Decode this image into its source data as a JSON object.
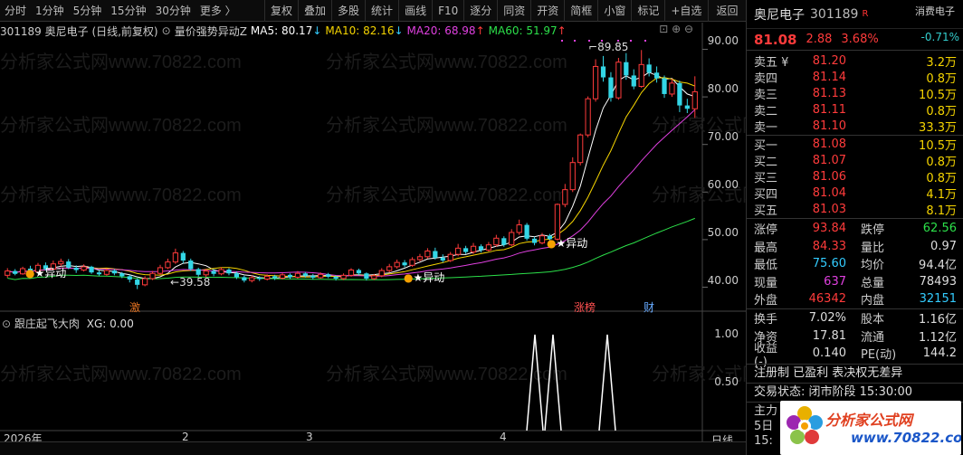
{
  "toolbar": {
    "period_tabs": [
      "分时",
      "1分钟",
      "5分钟",
      "15分钟",
      "30分钟",
      "更多 〉"
    ],
    "tool_buttons": [
      "复权",
      "叠加",
      "多股",
      "统计",
      "画线",
      "F10",
      "逐分",
      "同资",
      "开资",
      "简框",
      "小窗",
      "标记",
      "+自选"
    ],
    "back_label": "返回"
  },
  "indicator_bar": {
    "stock_info": "301189 奥尼电子 (日线,前复权)",
    "indicator_name": "量价强势异动Z",
    "ma5": "MA5: 80.17",
    "ma10": "MA10: 82.16",
    "ma20": "MA20: 68.98",
    "ma60": "MA60: 51.97"
  },
  "main_chart": {
    "axis_labels": [
      "90.00",
      "80.00",
      "70.00",
      "60.00",
      "50.00",
      "40.00"
    ],
    "high_annotation": "89.85",
    "low_annotation": "39.58",
    "signal_label": "★异动",
    "markers": {
      "ji": "激",
      "zhangting": "涨榜",
      "cai": "财"
    },
    "watermark": "分析家公式网www.70822.com"
  },
  "sub_chart": {
    "title": "跟庄起飞大肉",
    "xg_label": "XG: 0.00",
    "axis_labels": [
      "1.00",
      "0.50"
    ]
  },
  "time_axis": {
    "labels": [
      "2026年",
      "2",
      "3",
      "4"
    ],
    "period_label": "日线"
  },
  "colors": {
    "up": "#ff3b3b",
    "down": "#33d6e6",
    "ma5": "#ffffff",
    "ma10": "#f5d400",
    "ma20": "#e040e0",
    "ma60": "#2ce04a"
  },
  "quote": {
    "name": "奥尼电子",
    "code": "301189",
    "badge": "R",
    "sector_name": "消费电子",
    "sector_pct": "-0.71%",
    "price": "81.08",
    "change": "2.88",
    "pct": "3.68%",
    "asks": [
      {
        "label": "卖五 ¥",
        "price": "81.20",
        "vol": "3.2万"
      },
      {
        "label": "卖四",
        "price": "81.14",
        "vol": "0.8万"
      },
      {
        "label": "卖三",
        "price": "81.13",
        "vol": "10.5万"
      },
      {
        "label": "卖二",
        "price": "81.11",
        "vol": "0.8万"
      },
      {
        "label": "卖一",
        "price": "81.10",
        "vol": "33.3万"
      }
    ],
    "bids": [
      {
        "label": "买一",
        "price": "81.08",
        "vol": "10.5万"
      },
      {
        "label": "买二",
        "price": "81.07",
        "vol": "0.8万"
      },
      {
        "label": "买三",
        "price": "81.06",
        "vol": "0.8万"
      },
      {
        "label": "买四",
        "price": "81.04",
        "vol": "4.1万"
      },
      {
        "label": "买五",
        "price": "81.03",
        "vol": "8.1万"
      }
    ],
    "stats1": [
      {
        "k1": "涨停",
        "v1": "93.84",
        "k2": "跌停",
        "v2": "62.56"
      },
      {
        "k1": "最高",
        "v1": "84.33",
        "k2": "量比",
        "v2": "0.97"
      },
      {
        "k1": "最低",
        "v1": "75.60",
        "k2": "均价",
        "v2": "94.4亿"
      },
      {
        "k1": "现量",
        "v1": "637",
        "k2": "总量",
        "v2": "78493"
      },
      {
        "k1": "外盘",
        "v1": "46342",
        "k2": "内盘",
        "v2": "32151"
      }
    ],
    "stats2": [
      {
        "k1": "换手",
        "v1": "7.02%",
        "k2": "股本",
        "v2": "1.16亿"
      },
      {
        "k1": "净资",
        "v1": "17.81",
        "k2": "流通",
        "v2": "1.12亿"
      },
      {
        "k1": "收益(-)",
        "v1": "0.140",
        "k2": "PE(动)",
        "v2": "144.2"
      }
    ],
    "tags": "注册制 已盈利 表决权无差异",
    "status": "交易状态: 闭市阶段 15:30:00",
    "partial_1": "主力",
    "partial_2": "5日",
    "partial_3": "15:"
  },
  "logo": {
    "text": "分析家公式网",
    "url": "www.70822.com"
  },
  "chart_data": {
    "type": "candlestick",
    "title": "301189 奥尼电子 (日线,前复权)",
    "ylim": [
      38,
      92
    ],
    "series": [
      {
        "name": "MA5",
        "value": 80.17
      },
      {
        "name": "MA10",
        "value": 82.16
      },
      {
        "name": "MA20",
        "value": 68.98
      },
      {
        "name": "MA60",
        "value": 51.97
      }
    ],
    "candles": [
      [
        42.5,
        43.4,
        42.0,
        44.0
      ],
      [
        43.4,
        42.8,
        42.5,
        43.8
      ],
      [
        42.8,
        43.9,
        42.6,
        44.3
      ],
      [
        43.9,
        43.2,
        42.9,
        44.5
      ],
      [
        43.2,
        44.6,
        43.0,
        45.1
      ],
      [
        44.6,
        43.8,
        43.5,
        45.2
      ],
      [
        43.8,
        44.9,
        43.6,
        45.6
      ],
      [
        44.9,
        45.4,
        44.4,
        46.0
      ],
      [
        45.4,
        44.1,
        43.8,
        45.9
      ],
      [
        44.1,
        43.6,
        43.0,
        44.6
      ],
      [
        43.6,
        44.3,
        43.3,
        44.8
      ],
      [
        44.3,
        43.1,
        42.8,
        44.5
      ],
      [
        43.1,
        42.7,
        42.4,
        43.5
      ],
      [
        42.7,
        43.5,
        42.4,
        43.9
      ],
      [
        43.5,
        42.9,
        42.5,
        43.8
      ],
      [
        42.9,
        42.3,
        41.9,
        43.2
      ],
      [
        42.3,
        41.6,
        41.0,
        42.6
      ],
      [
        41.6,
        40.5,
        39.6,
        41.9
      ],
      [
        40.5,
        41.8,
        40.2,
        42.3
      ],
      [
        41.8,
        42.9,
        41.5,
        43.4
      ],
      [
        42.9,
        44.1,
        42.6,
        44.7
      ],
      [
        44.1,
        45.3,
        43.8,
        46.0
      ],
      [
        45.3,
        47.2,
        44.9,
        48.1
      ],
      [
        47.2,
        45.6,
        45.0,
        47.6
      ],
      [
        45.6,
        43.8,
        43.4,
        46.0
      ],
      [
        43.8,
        42.6,
        42.2,
        44.1
      ],
      [
        42.6,
        43.4,
        42.1,
        43.9
      ],
      [
        43.4,
        42.8,
        42.3,
        43.8
      ],
      [
        42.8,
        43.7,
        42.5,
        44.2
      ],
      [
        43.7,
        42.9,
        42.5,
        44.0
      ],
      [
        42.9,
        42.1,
        41.7,
        43.3
      ],
      [
        42.1,
        41.4,
        41.0,
        42.4
      ],
      [
        41.4,
        42.0,
        41.0,
        42.5
      ],
      [
        42.0,
        41.7,
        41.3,
        42.3
      ],
      [
        41.7,
        42.3,
        41.4,
        42.7
      ],
      [
        42.3,
        41.9,
        41.5,
        42.6
      ],
      [
        41.9,
        42.6,
        41.6,
        43.0
      ],
      [
        42.6,
        42.1,
        41.7,
        42.9
      ],
      [
        42.1,
        42.9,
        41.8,
        43.4
      ],
      [
        42.9,
        42.4,
        42.0,
        43.2
      ],
      [
        42.4,
        42.0,
        41.6,
        42.8
      ],
      [
        42.0,
        42.7,
        41.8,
        43.1
      ],
      [
        42.7,
        42.2,
        41.9,
        43.0
      ],
      [
        42.2,
        41.8,
        41.4,
        42.5
      ],
      [
        41.8,
        42.5,
        41.5,
        42.9
      ],
      [
        42.5,
        43.6,
        42.2,
        44.0
      ],
      [
        43.6,
        42.9,
        42.5,
        43.9
      ],
      [
        42.9,
        41.8,
        41.4,
        43.1
      ],
      [
        41.8,
        42.4,
        41.5,
        42.8
      ],
      [
        42.4,
        43.5,
        42.1,
        44.0
      ],
      [
        43.5,
        44.3,
        43.1,
        44.9
      ],
      [
        44.3,
        45.2,
        43.9,
        45.8
      ],
      [
        45.2,
        44.6,
        44.2,
        45.7
      ],
      [
        44.6,
        45.8,
        44.3,
        46.3
      ],
      [
        45.8,
        46.4,
        45.4,
        47.0
      ],
      [
        46.4,
        47.6,
        46.0,
        48.2
      ],
      [
        47.6,
        46.2,
        45.8,
        48.3
      ],
      [
        46.2,
        45.6,
        45.2,
        46.9
      ],
      [
        45.6,
        46.9,
        45.3,
        47.4
      ],
      [
        46.9,
        48.2,
        46.5,
        49.1
      ],
      [
        48.2,
        47.4,
        47.0,
        48.7
      ],
      [
        47.4,
        48.6,
        47.0,
        49.3
      ],
      [
        48.6,
        47.8,
        47.3,
        49.0
      ],
      [
        47.8,
        48.9,
        47.5,
        49.5
      ],
      [
        48.9,
        50.3,
        48.5,
        51.0
      ],
      [
        50.3,
        48.9,
        48.5,
        50.7
      ],
      [
        48.9,
        51.5,
        48.6,
        52.2
      ],
      [
        51.5,
        53.1,
        51.0,
        54.2
      ],
      [
        53.1,
        50.2,
        49.8,
        53.5
      ],
      [
        50.2,
        49.3,
        48.8,
        50.6
      ],
      [
        49.3,
        50.8,
        49.0,
        51.4
      ],
      [
        50.8,
        50.1,
        49.6,
        51.2
      ],
      [
        50.1,
        57.4,
        49.8,
        57.6
      ],
      [
        57.4,
        60.5,
        56.8,
        61.7
      ],
      [
        60.5,
        66.2,
        60.0,
        67.3
      ],
      [
        66.2,
        72.0,
        65.6,
        72.3
      ],
      [
        72.0,
        79.6,
        71.5,
        80.1
      ],
      [
        79.6,
        86.4,
        79.0,
        87.9
      ],
      [
        86.4,
        84.1,
        83.2,
        88.6
      ],
      [
        84.1,
        79.8,
        79.0,
        85.2
      ],
      [
        79.8,
        87.3,
        79.4,
        88.2
      ],
      [
        87.3,
        84.5,
        83.6,
        89.2
      ],
      [
        84.5,
        82.2,
        81.6,
        85.8
      ],
      [
        82.2,
        86.8,
        81.9,
        89.85
      ],
      [
        86.8,
        85.1,
        84.3,
        88.1
      ],
      [
        85.1,
        83.9,
        83.0,
        86.4
      ],
      [
        83.9,
        80.6,
        79.8,
        84.5
      ],
      [
        80.6,
        82.9,
        80.0,
        83.8
      ],
      [
        82.9,
        78.2,
        76.8,
        83.4
      ],
      [
        78.2,
        77.5,
        76.6,
        79.6
      ],
      [
        77.5,
        81.08,
        75.6,
        84.33
      ]
    ],
    "signals": [
      1,
      0,
      0,
      0,
      1
    ]
  }
}
